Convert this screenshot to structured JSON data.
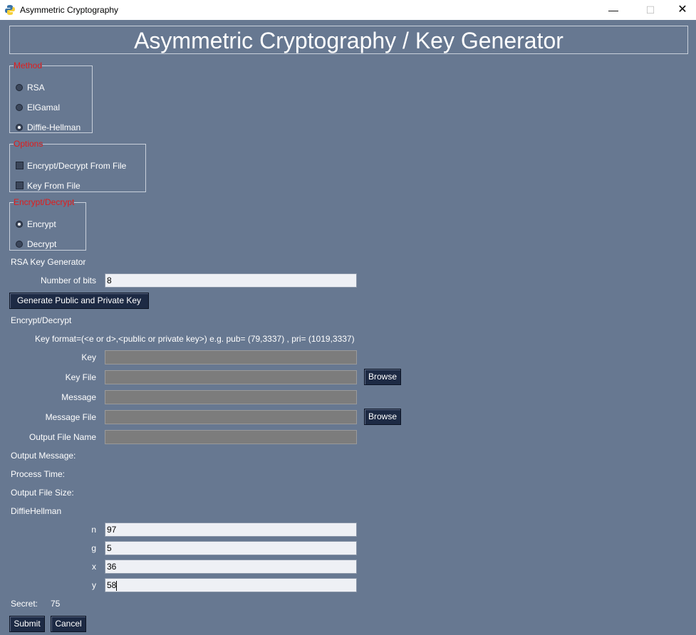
{
  "window": {
    "title": "Asymmetric Cryptography",
    "minimize": "—",
    "maximize": "☐",
    "close": "✕"
  },
  "banner": "Asymmetric Cryptography / Key Generator",
  "method": {
    "legend": "Method",
    "options": [
      "RSA",
      "ElGamal",
      "Diffie-Hellman"
    ],
    "selected": "Diffie-Hellman"
  },
  "options": {
    "legend": "Options",
    "items": [
      "Encrypt/Decrypt From File",
      "Key From File"
    ]
  },
  "encdec": {
    "legend": "Encrypt/Decrypt",
    "options": [
      "Encrypt",
      "Decrypt"
    ],
    "selected": "Encrypt"
  },
  "rsa": {
    "heading": "RSA Key Generator",
    "bits_label": "Number of bits",
    "bits_value": "8",
    "generate_label": "Generate Public and Private Key"
  },
  "encrypt_section": {
    "heading": "Encrypt/Decrypt",
    "key_format": "Key format=(<e or d>,<public or private key>) e.g. pub= (79,3337) , pri= (1019,3337)",
    "key_label": "Key",
    "key_file_label": "Key File",
    "message_label": "Message",
    "message_file_label": "Message File",
    "output_file_label": "Output File Name",
    "browse_label": "Browse"
  },
  "results": {
    "output_message": "Output Message:",
    "process_time": "Process Time:",
    "output_file_size": "Output File Size:"
  },
  "dh": {
    "heading": "DiffieHellman",
    "n_label": "n",
    "n_value": "97",
    "g_label": "g",
    "g_value": "5",
    "x_label": "x",
    "x_value": "36",
    "y_label": "y",
    "y_value": "58"
  },
  "secret": {
    "label": "Secret:",
    "value": "75"
  },
  "actions": {
    "submit": "Submit",
    "cancel": "Cancel"
  }
}
